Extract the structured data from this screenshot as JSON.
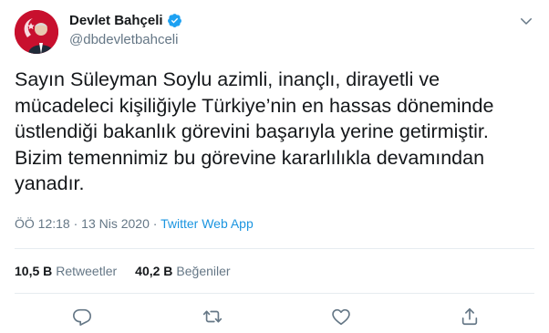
{
  "author": {
    "display_name": "Devlet Bahçeli",
    "handle": "@dbdevletbahceli",
    "verified": true,
    "avatar_icon": "profile-photo-icon"
  },
  "tweet": {
    "text": "Sayın Süleyman Soylu azimli, inançlı, dirayetli ve\nmücadeleci kişiliğiyle Türkiye’nin en hassas döneminde\nüstlendiği bakanlık görevini başarıyla yerine getirmiştir.\nBizim temennimiz bu görevine kararlılıkla devamından\nyanadır.",
    "time": "ÖÖ 12:18",
    "separator": " · ",
    "date": "13 Nis 2020",
    "source": "Twitter Web App"
  },
  "stats": {
    "retweets_count": "10,5 B",
    "retweets_label": "Retweetler",
    "likes_count": "40,2 B",
    "likes_label": "Beğeniler"
  },
  "icons": {
    "more": "chevron-down-icon",
    "reply": "reply-icon",
    "retweet": "retweet-icon",
    "like": "heart-icon",
    "share": "share-icon"
  },
  "colors": {
    "text": "#14171a",
    "secondary": "#657786",
    "link": "#1b95e0",
    "verified": "#1da1f2",
    "divider": "#e6ecf0",
    "avatar_bg": "#c8102e"
  }
}
